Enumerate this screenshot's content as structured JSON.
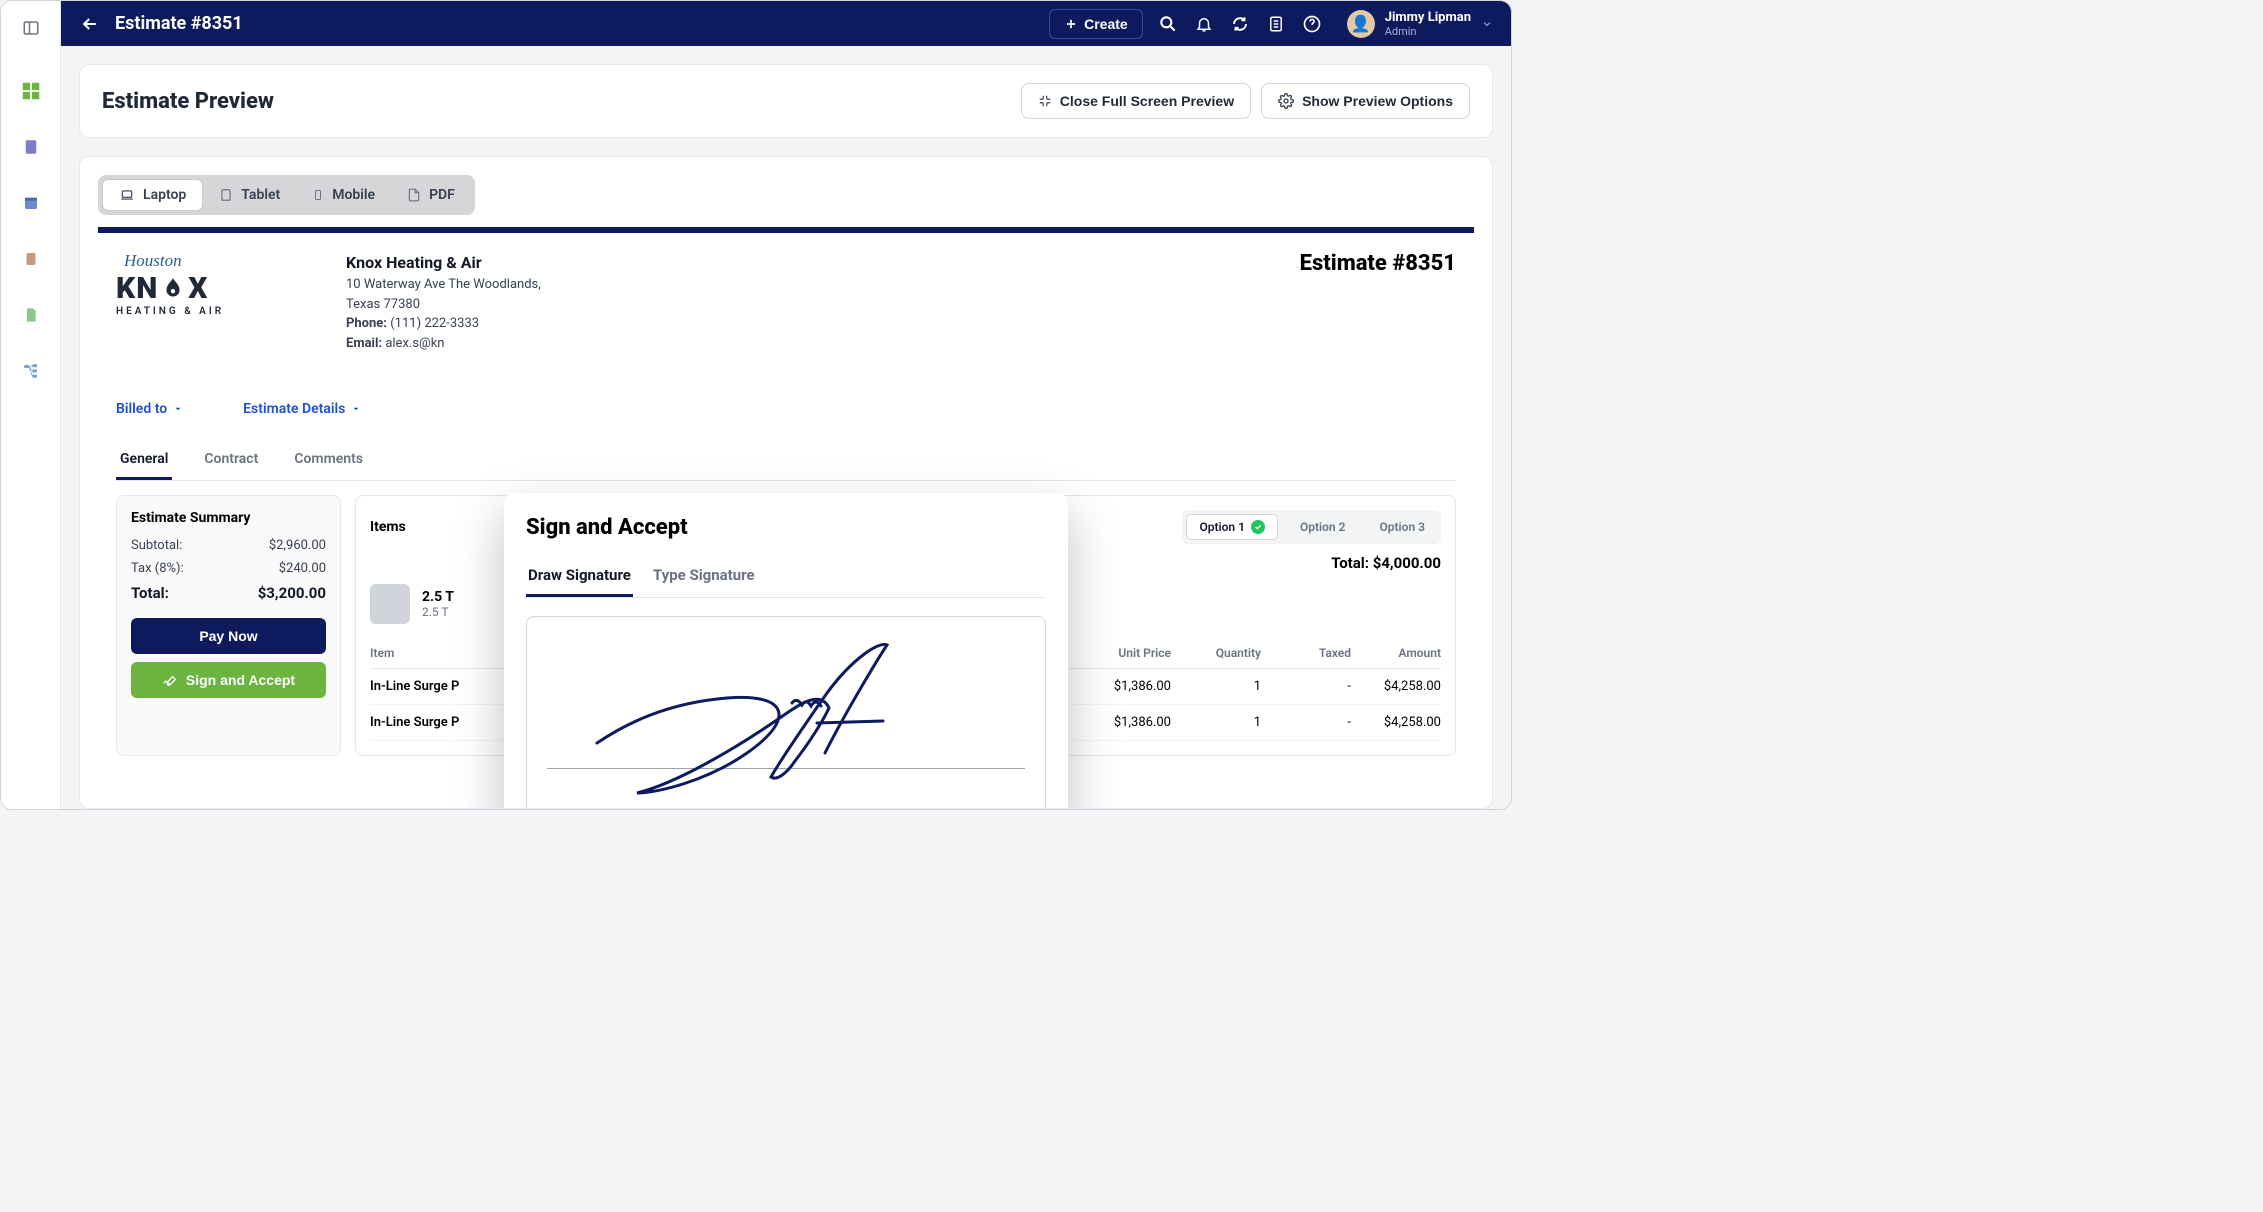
{
  "header": {
    "title": "Estimate #8351",
    "create_label": "Create",
    "user_name": "Jimmy Lipman",
    "user_role": "Admin"
  },
  "preview": {
    "title": "Estimate Preview",
    "close_label": "Close Full Screen Preview",
    "options_label": "Show Preview Options"
  },
  "device_tabs": [
    "Laptop",
    "Tablet",
    "Mobile",
    "PDF"
  ],
  "company": {
    "name": "Knox Heating & Air",
    "addr1": "10 Waterway Ave The Woodlands,",
    "addr2": "Texas 77380",
    "phone_label": "Phone:",
    "phone": "(111) 222-3333",
    "email_label": "Email:",
    "email_partial": "alex.s@kn",
    "logo_sub": "Houston",
    "logo_main": "KN  X",
    "logo_tag": "HEATING & AIR"
  },
  "doc_est_label": "Estimate #8351",
  "blue_links": {
    "billed": "Billed to",
    "details": "Estimate Details"
  },
  "doc_tabs": [
    "General",
    "Contract",
    "Comments"
  ],
  "summary": {
    "title": "Estimate Summary",
    "subtotal_label": "Subtotal:",
    "subtotal": "$2,960.00",
    "tax_label": "Tax (8%):",
    "tax": "$240.00",
    "total_label": "Total:",
    "total": "$3,200.00",
    "pay_label": "Pay Now",
    "sign_label": "Sign and Accept"
  },
  "items": {
    "title": "Items",
    "options": [
      "Option 1",
      "Option 2",
      "Option 3"
    ],
    "total_label": "Total: $4,000.00",
    "line_title": "2.5 T",
    "line_sub": "2.5 T",
    "cols": {
      "item": "Item",
      "price": "Unit Price",
      "qty": "Quantity",
      "taxed": "Taxed",
      "amount": "Amount"
    },
    "rows": [
      {
        "name": "In-Line Surge P",
        "price": "$1,386.00",
        "qty": "1",
        "taxed": "-",
        "amount": "$4,258.00"
      },
      {
        "name": "In-Line Surge P",
        "price": "$1,386.00",
        "qty": "1",
        "taxed": "-",
        "amount": "$4,258.00"
      }
    ]
  },
  "modal": {
    "title": "Sign and Accept",
    "tab_draw": "Draw Signature",
    "tab_type": "Type Signature"
  }
}
